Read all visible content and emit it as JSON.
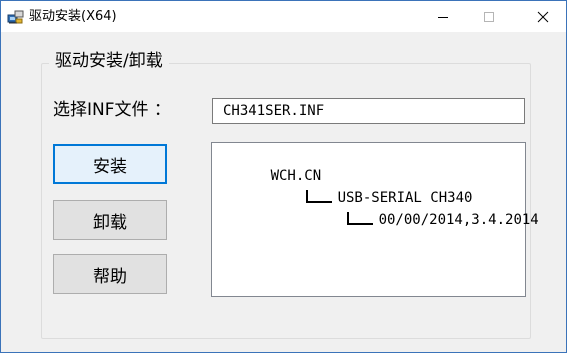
{
  "window": {
    "title": "驱动安装(X64)",
    "title_icon": "driver-install-icon",
    "controls": {
      "minimize_icon": "minimize-icon",
      "maximize_icon": "maximize-icon",
      "close_icon": "close-icon"
    }
  },
  "group": {
    "title": "驱动安装/卸载"
  },
  "inf": {
    "label": "选择INF文件 ：",
    "value": "CH341SER.INF"
  },
  "buttons": {
    "install": "安装",
    "uninstall": "卸载",
    "help": "帮助"
  },
  "driver_info": {
    "vendor": "WCH.CN",
    "device": "USB-SERIAL CH340",
    "version": "00/00/2014,3.4.2014"
  },
  "colors": {
    "focus_border": "#0078d7",
    "window_border": "#3b73b9",
    "face": "#f0f0f0"
  }
}
